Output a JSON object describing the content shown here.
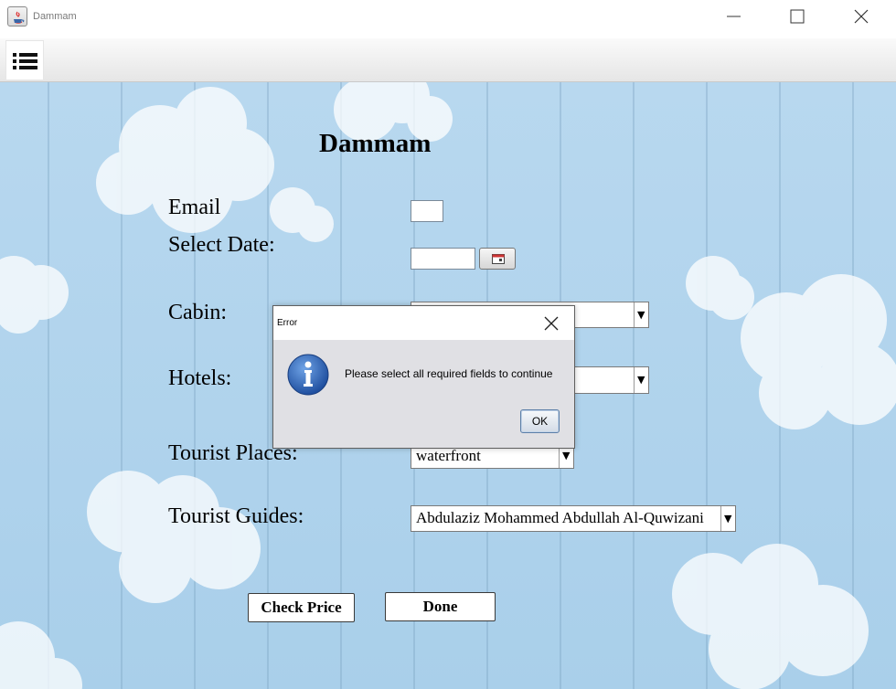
{
  "window": {
    "title": "Dammam",
    "icon": "java-icon"
  },
  "toolbar": {
    "menu_icon": "list-icon"
  },
  "form": {
    "heading": "Dammam",
    "email_label": "Email",
    "email_value": "",
    "date_label": "Select Date:",
    "date_value": "",
    "cabin_label": "Cabin:",
    "cabin_value": "",
    "hotels_label": "Hotels:",
    "hotels_value": "",
    "tourist_places_label": "Tourist Places:",
    "tourist_places_value": "waterfront",
    "tourist_guides_label": "Tourist Guides:",
    "tourist_guides_value": "Abdulaziz Mohammed Abdullah Al-Quwizani",
    "check_price_label": "Check Price",
    "done_label": "Done"
  },
  "dialog": {
    "title": "Error",
    "message": "Please select all required fields to continue",
    "ok_label": "OK",
    "icon": "info-icon"
  },
  "colors": {
    "sky": "#b8d8ef",
    "info_blue": "#2f63b6"
  }
}
